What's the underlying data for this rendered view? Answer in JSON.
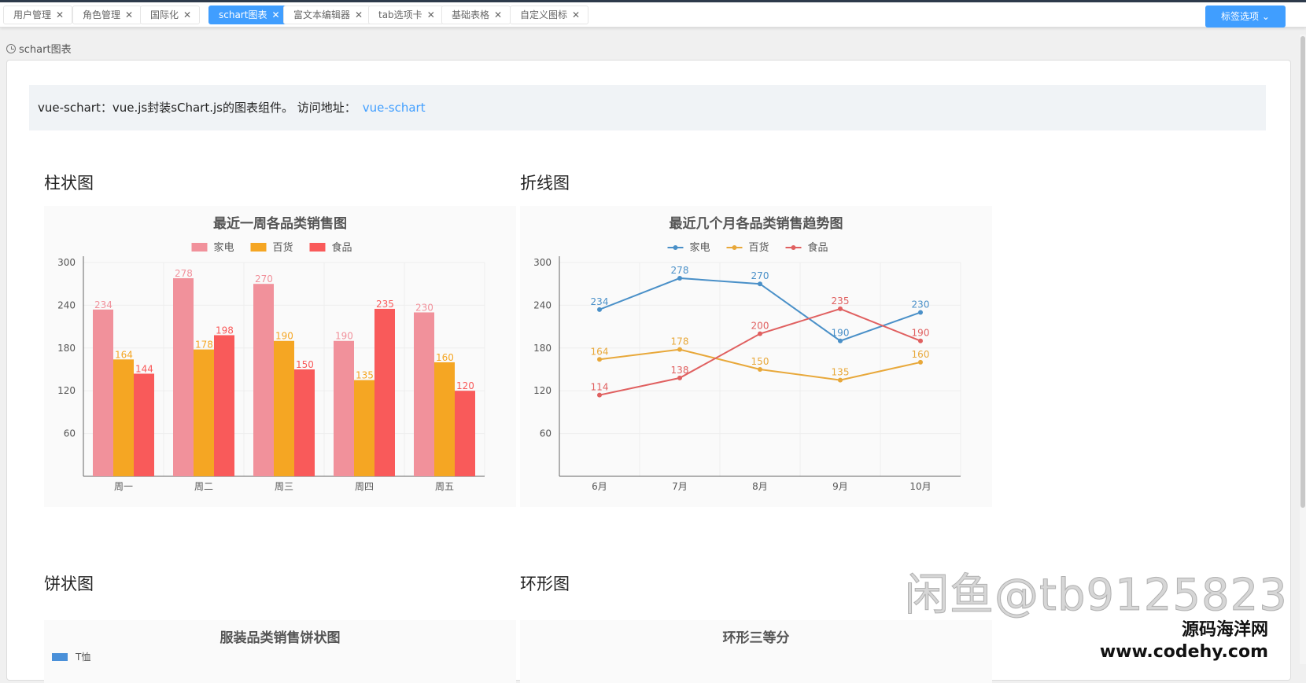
{
  "tabs": [
    {
      "label": "用户管理",
      "active": false
    },
    {
      "label": "角色管理",
      "active": false
    },
    {
      "label": "国际化",
      "active": false
    },
    {
      "label": "schart图表",
      "active": true
    },
    {
      "label": "富文本编辑器",
      "active": false
    },
    {
      "label": "tab选项卡",
      "active": false
    },
    {
      "label": "基础表格",
      "active": false
    },
    {
      "label": "自定义图标",
      "active": false
    }
  ],
  "tag_options_label": "标签选项",
  "breadcrumb": "schart图表",
  "notice": {
    "text": "vue-schart：vue.js封装sChart.js的图表组件。 访问地址：",
    "link": "vue-schart"
  },
  "sections": {
    "bar": "柱状图",
    "line": "折线图",
    "pie": "饼状图",
    "ring": "环形图"
  },
  "pie_preview": {
    "title": "服装品类销售饼状图",
    "legend_first": "T恤"
  },
  "ring_preview": {
    "title": "环形三等分"
  },
  "watermark": {
    "line1": "闲鱼@tb9125823",
    "line2": "源码海洋网",
    "line3": "www.codehy.com"
  },
  "colors": {
    "primary": "#409eff",
    "series": [
      "#f1919b",
      "#f5a623",
      "#f95a5a"
    ],
    "line_series": [
      "#4a90c8",
      "#e8a83a",
      "#e06060"
    ]
  },
  "chart_data": [
    {
      "type": "bar",
      "title": "最近一周各品类销售图",
      "categories": [
        "周一",
        "周二",
        "周三",
        "周四",
        "周五"
      ],
      "series": [
        {
          "name": "家电",
          "values": [
            234,
            278,
            270,
            190,
            230
          ]
        },
        {
          "name": "百货",
          "values": [
            164,
            178,
            190,
            135,
            160
          ]
        },
        {
          "name": "食品",
          "values": [
            144,
            198,
            150,
            235,
            120
          ]
        }
      ],
      "yticks": [
        60,
        120,
        180,
        240,
        300
      ],
      "ylim": [
        0,
        300
      ],
      "legend": "top-center",
      "grid": true
    },
    {
      "type": "line",
      "title": "最近几个月各品类销售趋势图",
      "categories": [
        "6月",
        "7月",
        "8月",
        "9月",
        "10月"
      ],
      "series": [
        {
          "name": "家电",
          "values": [
            234,
            278,
            270,
            190,
            230
          ]
        },
        {
          "name": "百货",
          "values": [
            164,
            178,
            150,
            135,
            160
          ]
        },
        {
          "name": "食品",
          "values": [
            114,
            138,
            200,
            235,
            190
          ]
        }
      ],
      "yticks": [
        60,
        120,
        180,
        240,
        300
      ],
      "ylim": [
        0,
        300
      ],
      "legend": "top-center",
      "grid": true
    }
  ]
}
